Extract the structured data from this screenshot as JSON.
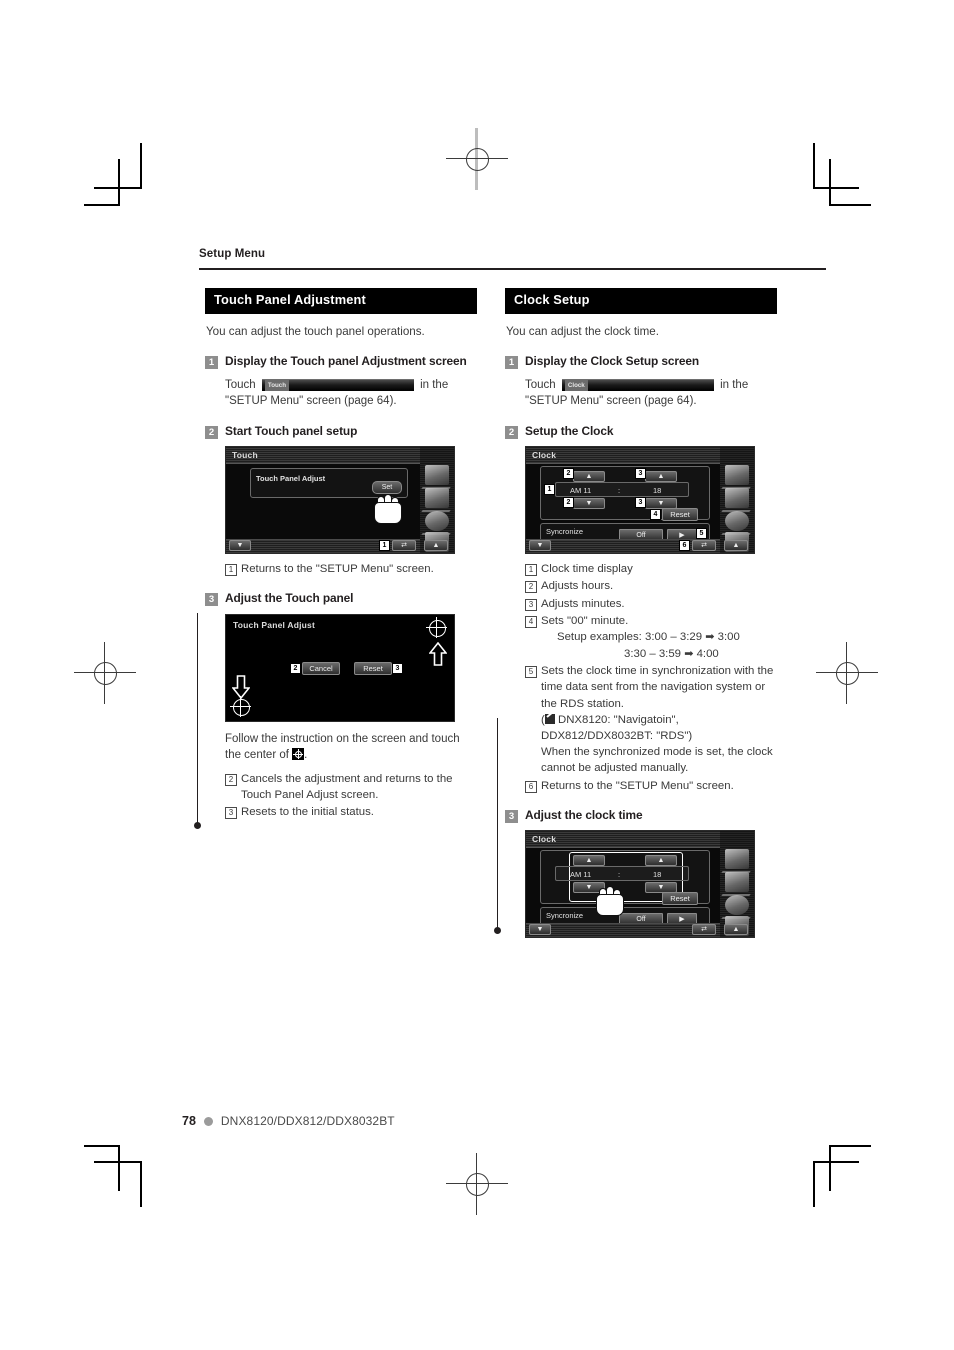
{
  "page": {
    "running_head": "Setup Menu",
    "page_number": "78",
    "models": "DNX8120/DDX812/DDX8032BT"
  },
  "left_column": {
    "section_title": "Touch Panel Adjustment",
    "lead": "You can adjust the touch panel operations.",
    "steps": [
      {
        "num": "1",
        "title": "Display the Touch panel Adjustment screen",
        "body_before": "Touch",
        "pill_label": "Touch",
        "body_after": "in the \"SETUP Menu\" screen (page 64)."
      },
      {
        "num": "2",
        "title": "Start Touch panel setup",
        "screen": {
          "title": "Touch",
          "panel_label": "Touch Panel Adjust",
          "set_button": "Set",
          "callout": "1"
        },
        "refs": [
          {
            "num": "1",
            "text": "Returns to the \"SETUP Menu\" screen."
          }
        ]
      },
      {
        "num": "3",
        "title": "Adjust the Touch panel",
        "screen": {
          "title": "Touch Panel Adjust",
          "cancel_button": "Cancel",
          "reset_button": "Reset",
          "cancel_callout": "2",
          "reset_callout": "3"
        },
        "body": "Follow the instruction on the screen and touch the center of",
        "body_tail": ".",
        "refs": [
          {
            "num": "2",
            "text": "Cancels the adjustment and returns to the Touch Panel Adjust screen."
          },
          {
            "num": "3",
            "text": "Resets to the initial status."
          }
        ]
      }
    ]
  },
  "right_column": {
    "section_title": "Clock Setup",
    "lead": "You can adjust the clock time.",
    "steps": [
      {
        "num": "1",
        "title": "Display the Clock Setup screen",
        "body_before": "Touch",
        "pill_label": "Clock",
        "body_after": "in the \"SETUP Menu\" screen (page 64)."
      },
      {
        "num": "2",
        "title": "Setup the Clock",
        "screen": {
          "title": "Clock",
          "hour_value": "AM 11",
          "separator": ":",
          "minute_value": "18",
          "reset_button": "Reset",
          "sync_label": "Syncronize",
          "sync_value": "Off",
          "callouts": [
            "1",
            "2",
            "3",
            "4",
            "5",
            "6"
          ]
        },
        "refs": [
          {
            "num": "1",
            "text": "Clock time display"
          },
          {
            "num": "2",
            "text": "Adjusts hours."
          },
          {
            "num": "3",
            "text": "Adjusts minutes."
          },
          {
            "num": "4",
            "text": "Sets \"00\" minute."
          },
          {
            "num": "5",
            "text": "Sets the clock time in synchronization with the time data sent from the navigation system or the RDS station."
          },
          {
            "num": "6",
            "text": "Returns to the \"SETUP Menu\" screen."
          }
        ],
        "example_label": "Setup examples:",
        "example_line1_from": "3:00 – 3:29",
        "example_line1_to": "3:00",
        "example_line2_from": "3:30 – 3:59",
        "example_line2_to": "4:00",
        "note_models": "DNX8120: \"Navigatoin\", DDX812/DDX8032BT: \"RDS\")",
        "note_models_open": "(",
        "note_sync": "When the synchronized mode is set, the clock cannot be adjusted manually."
      },
      {
        "num": "3",
        "title": "Adjust the clock time",
        "screen": {
          "title": "Clock",
          "hour_value": "AM 11",
          "separator": ":",
          "minute_value": "18",
          "reset_button": "Reset",
          "sync_label": "Syncronize",
          "sync_value": "Off"
        }
      }
    ]
  },
  "colors": {
    "ink": "#231f20",
    "section_header_bg": "#000000",
    "step_badge_bg": "#8e8e8e",
    "body_text": "#3a3a3a",
    "footer_dot": "#9b9b9b"
  },
  "icons": {
    "crosshair": "crosshair-icon",
    "pen": "pen-note-icon",
    "arrow_right": "arrow-right-icon",
    "hand": "pointing-hand-icon",
    "up": "triangle-up-icon",
    "down": "triangle-down-icon",
    "back": "return-arrow-icon"
  }
}
